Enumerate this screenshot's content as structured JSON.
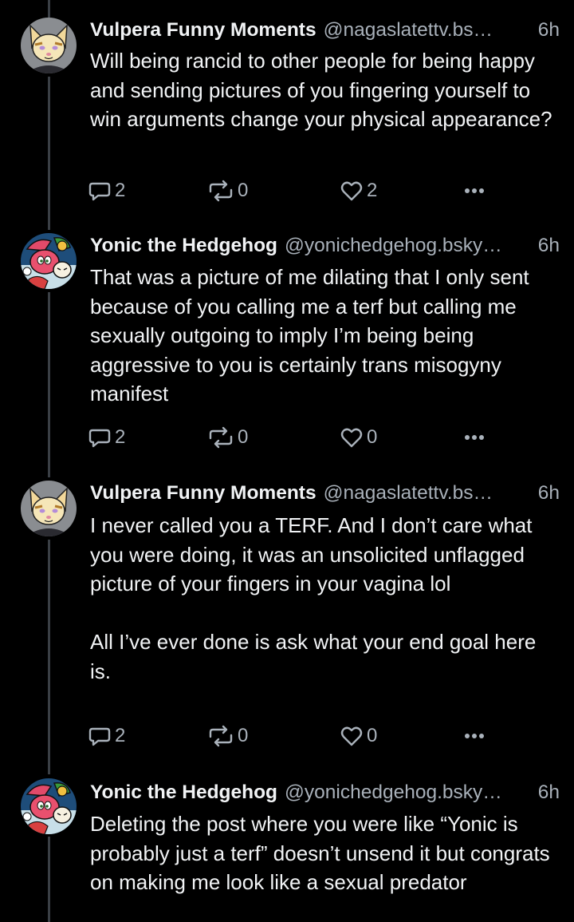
{
  "colors": {
    "background": "#000000",
    "text": "#f1f3f5",
    "muted": "#a8b0b9",
    "thread_line": "#3a3f45"
  },
  "posts": [
    {
      "display_name": "Vulpera Funny Moments",
      "handle": "@nagaslatettv.bs…",
      "age": "6h",
      "avatar": "fox-avatar",
      "text": "Will being rancid to other people for being happy and sending pictures of you fingering yourself to win arguments change your physical appearance?",
      "replies": "2",
      "reposts": "0",
      "likes": "2"
    },
    {
      "display_name": "Yonic the Hedgehog",
      "handle": "@yonichedgehog.bsky…",
      "age": "6h",
      "avatar": "hedgehog-avatar",
      "text": "That was a picture of me dilating that I only sent because of you calling me a terf but calling me sexually outgoing to imply I’m being being aggressive to you is certainly trans misogyny manifest",
      "replies": "2",
      "reposts": "0",
      "likes": "0"
    },
    {
      "display_name": "Vulpera Funny Moments",
      "handle": "@nagaslatettv.bs…",
      "age": "6h",
      "avatar": "fox-avatar",
      "text": "I never called you a TERF. And I don’t care what you were doing, it was an unsolicited unflagged picture of your fingers in your vagina lol\n\nAll I’ve ever done is ask what your end goal here is.",
      "replies": "2",
      "reposts": "0",
      "likes": "0"
    },
    {
      "display_name": "Yonic the Hedgehog",
      "handle": "@yonichedgehog.bsky…",
      "age": "6h",
      "avatar": "hedgehog-avatar",
      "text": "Deleting the post where you were like “Yonic is probably just a terf” doesn’t unsend it but congrats on making me look like a sexual predator"
    }
  ]
}
